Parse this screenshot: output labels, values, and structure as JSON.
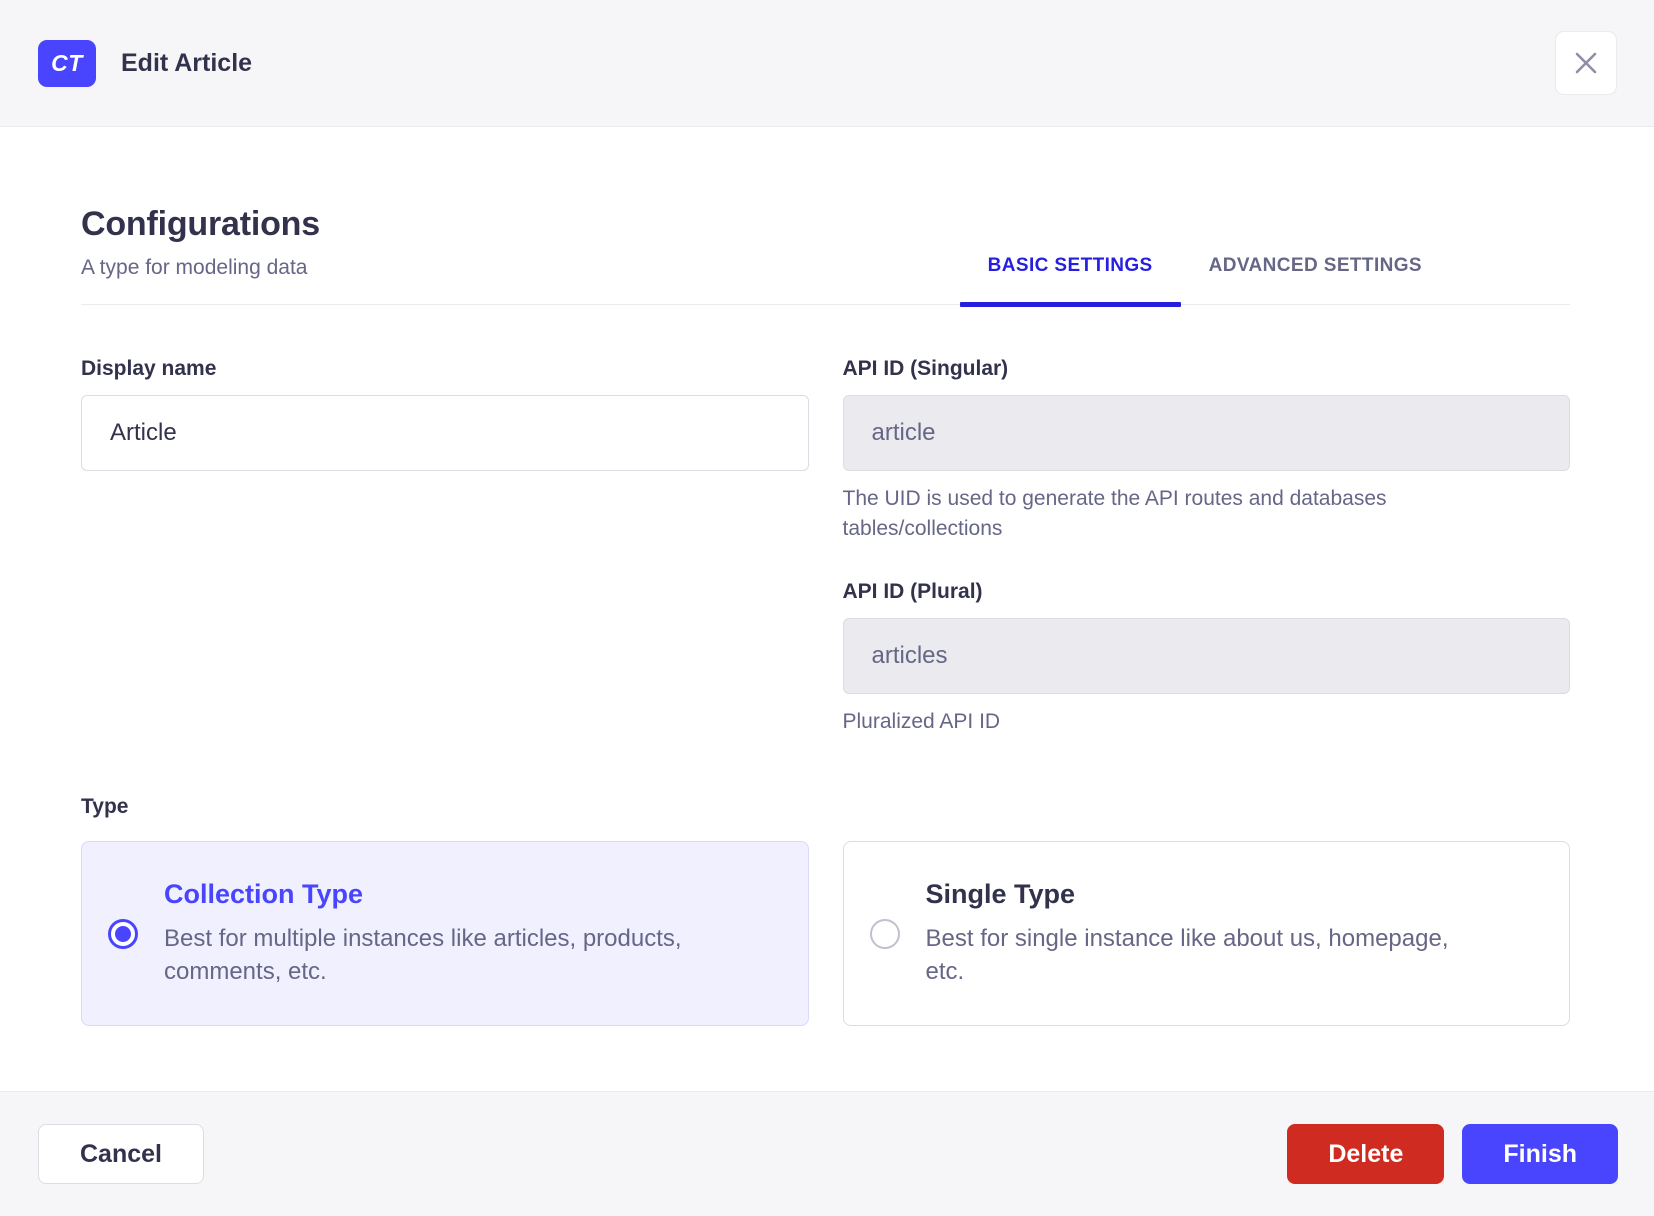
{
  "header": {
    "badge": "CT",
    "title": "Edit Article"
  },
  "section": {
    "title": "Configurations",
    "subtitle": "A type for modeling data",
    "tabs": [
      {
        "label": "BASIC SETTINGS",
        "active": true
      },
      {
        "label": "ADVANCED SETTINGS",
        "active": false
      }
    ]
  },
  "form": {
    "display_name": {
      "label": "Display name",
      "value": "Article"
    },
    "api_id_singular": {
      "label": "API ID (Singular)",
      "value": "article",
      "hint": "The UID is used to generate the API routes and databases tables/collections"
    },
    "api_id_plural": {
      "label": "API ID (Plural)",
      "value": "articles",
      "hint": "Pluralized API ID"
    },
    "type": {
      "label": "Type",
      "options": [
        {
          "title": "Collection Type",
          "description": "Best for multiple instances like articles, products, comments, etc.",
          "selected": true
        },
        {
          "title": "Single Type",
          "description": "Best for single instance like about us, homepage, etc.",
          "selected": false
        }
      ]
    }
  },
  "footer": {
    "cancel": "Cancel",
    "delete": "Delete",
    "finish": "Finish"
  },
  "colors": {
    "primary": "#4945ff",
    "primary_active_tab": "#271fe0",
    "danger": "#d02b20",
    "neutral_bg": "#f6f6f9",
    "border_light": "#eaeaef",
    "border": "#dcdce4",
    "text_dark": "#32324d",
    "text_gray": "#666687",
    "disabled_bg": "#eaeaef",
    "card_selected_bg": "#f0f0ff",
    "card_selected_border": "#d9d8ff",
    "icon_gray": "#8e8ea9"
  }
}
